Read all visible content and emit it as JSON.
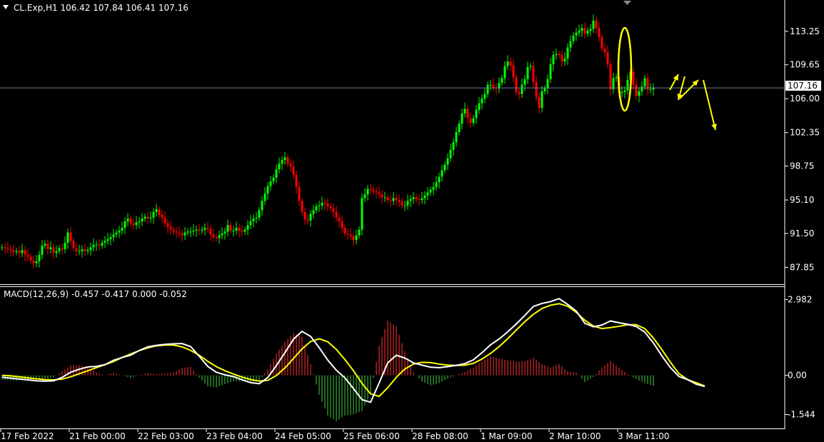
{
  "header": {
    "symbol_text": "CL.Exp,H1  106.42 107.84 106.41 107.16"
  },
  "macd_header": {
    "text": "MACD(12,26,9) -0.457 -0.417 0.000 -0.052"
  },
  "current_price_label": "107.16",
  "colors": {
    "background": "#000000",
    "bull": "#00ff00",
    "bear": "#ff0000",
    "axis": "#ffffff",
    "price_line": "#6f7f9a",
    "macd_line": "#ffffff",
    "signal_line": "#ffff00",
    "hist_pos": "#b22222",
    "hist_neg": "#2e8b2e",
    "annotation": "#ffff00"
  },
  "chart_data": [
    {
      "type": "candlestick",
      "title": "CL.Exp,H1",
      "ohlc_last": {
        "open": 106.42,
        "high": 107.84,
        "low": 106.41,
        "close": 107.16
      },
      "ylim": [
        86.5,
        116.0
      ],
      "y_ticks": [
        "113.25",
        "109.65",
        "106.00",
        "102.35",
        "98.75",
        "95.10",
        "91.50",
        "87.85"
      ],
      "y_tick_values": [
        113.25,
        109.65,
        106.0,
        102.35,
        98.75,
        95.1,
        91.5,
        87.85
      ],
      "x_ticks": [
        "17 Feb 2022",
        "21 Feb 00:00",
        "22 Feb 03:00",
        "23 Feb 04:00",
        "24 Feb 05:00",
        "25 Feb 06:00",
        "28 Feb 08:00",
        "1 Mar 09:00",
        "2 Mar 10:00",
        "3 Mar 11:00"
      ],
      "x_tick_bars": [
        0,
        24,
        48,
        72,
        96,
        120,
        144,
        168,
        192,
        216
      ],
      "closes": [
        90.0,
        89.9,
        89.8,
        89.7,
        89.5,
        89.6,
        89.4,
        89.7,
        89.2,
        89.0,
        88.6,
        88.3,
        88.5,
        89.2,
        90.2,
        90.4,
        89.8,
        90.0,
        89.4,
        89.6,
        89.9,
        89.8,
        90.5,
        91.6,
        90.7,
        89.9,
        89.6,
        89.6,
        89.8,
        89.6,
        89.7,
        90.0,
        90.3,
        90.3,
        90.2,
        90.5,
        90.7,
        90.9,
        91.1,
        91.4,
        91.6,
        91.8,
        92.1,
        92.8,
        93.1,
        92.6,
        92.4,
        92.7,
        92.8,
        93.1,
        93.3,
        93.1,
        93.2,
        93.8,
        94.1,
        93.5,
        93.2,
        92.6,
        92.2,
        91.9,
        91.7,
        91.6,
        91.5,
        91.3,
        91.6,
        91.7,
        91.7,
        91.8,
        91.9,
        91.8,
        91.9,
        92.1,
        92.0,
        91.4,
        91.1,
        91.0,
        91.3,
        91.5,
        91.7,
        92.4,
        91.8,
        91.8,
        92.1,
        91.8,
        91.7,
        91.9,
        92.4,
        92.8,
        93.1,
        93.2,
        94.0,
        95.0,
        95.8,
        96.6,
        97.1,
        97.5,
        98.4,
        99.0,
        99.4,
        99.7,
        99.0,
        98.7,
        97.8,
        96.5,
        95.0,
        93.8,
        93.0,
        92.9,
        93.6,
        94.0,
        94.4,
        94.5,
        94.8,
        94.7,
        94.4,
        94.2,
        93.8,
        93.2,
        92.8,
        92.1,
        91.5,
        91.4,
        91.2,
        90.8,
        91.3,
        91.9,
        95.3,
        95.7,
        96.3,
        96.2,
        96.0,
        95.9,
        95.7,
        95.4,
        95.4,
        95.1,
        95.0,
        95.3,
        95.1,
        94.9,
        94.5,
        94.5,
        95.0,
        95.2,
        95.4,
        95.2,
        95.1,
        95.3,
        95.6,
        95.9,
        96.2,
        96.5,
        97.0,
        97.6,
        98.3,
        98.9,
        99.6,
        100.5,
        101.3,
        102.4,
        103.3,
        104.4,
        104.9,
        103.9,
        103.4,
        103.9,
        104.8,
        105.5,
        106.0,
        106.5,
        107.5,
        107.5,
        107.2,
        107.1,
        107.7,
        108.2,
        109.5,
        110.0,
        109.6,
        108.3,
        106.7,
        106.5,
        107.5,
        108.1,
        109.4,
        109.5,
        107.8,
        106.2,
        105.0,
        106.8,
        107.1,
        108.1,
        109.7,
        110.7,
        110.8,
        110.7,
        110.0,
        110.3,
        111.5,
        112.2,
        112.8,
        113.1,
        113.3,
        113.6,
        113.0,
        113.3,
        113.5,
        114.4,
        113.6,
        112.6,
        111.4,
        111.0,
        109.7,
        107.0,
        108.2,
        108.3,
        106.6,
        106.7,
        106.9,
        108.0,
        108.9,
        107.5,
        106.3,
        106.8,
        107.3,
        108.2,
        107.0,
        107.0,
        107.2
      ],
      "series": [
        {
          "name": "",
          "values": []
        }
      ]
    },
    {
      "type": "line",
      "title": "MACD(12,26,9)",
      "values_header": [
        -0.457,
        -0.417,
        0.0,
        -0.052
      ],
      "ylim": [
        -1.98,
        3.25
      ],
      "y_ticks": [
        "2.982",
        "0.00",
        "-1.544"
      ],
      "y_tick_values": [
        2.982,
        0.0,
        -1.544
      ],
      "zero_line": 0.0,
      "macd": [
        -0.08,
        -0.11,
        -0.15,
        -0.18,
        -0.22,
        -0.23,
        -0.22,
        -0.08,
        0.12,
        0.24,
        0.33,
        0.35,
        0.42,
        0.59,
        0.7,
        0.79,
        0.98,
        1.12,
        1.18,
        1.22,
        1.24,
        1.25,
        1.13,
        0.75,
        0.35,
        0.12,
        0.02,
        -0.05,
        -0.18,
        -0.29,
        -0.33,
        -0.09,
        0.38,
        0.89,
        1.42,
        1.73,
        1.53,
        1.09,
        0.6,
        0.2,
        -0.1,
        -0.52,
        -0.96,
        -1.06,
        -0.3,
        0.49,
        0.79,
        0.68,
        0.49,
        0.4,
        0.32,
        0.3,
        0.34,
        0.39,
        0.46,
        0.61,
        0.89,
        1.2,
        1.43,
        1.71,
        2.02,
        2.36,
        2.71,
        2.83,
        2.9,
        3.02,
        2.79,
        2.53,
        2.05,
        1.91,
        1.98,
        2.14,
        2.07,
        2.01,
        1.92,
        1.7,
        1.28,
        0.76,
        0.3,
        -0.05,
        -0.17,
        -0.35,
        -0.44
      ],
      "signal": [
        0.0,
        -0.02,
        -0.06,
        -0.1,
        -0.14,
        -0.17,
        -0.18,
        -0.15,
        -0.06,
        0.06,
        0.18,
        0.3,
        0.42,
        0.54,
        0.7,
        0.84,
        0.97,
        1.08,
        1.16,
        1.19,
        1.19,
        1.12,
        0.98,
        0.79,
        0.55,
        0.34,
        0.18,
        0.05,
        -0.07,
        -0.17,
        -0.23,
        -0.2,
        -0.01,
        0.29,
        0.66,
        1.04,
        1.33,
        1.44,
        1.32,
        1.02,
        0.62,
        0.18,
        -0.32,
        -0.73,
        -0.83,
        -0.49,
        -0.08,
        0.25,
        0.44,
        0.51,
        0.5,
        0.44,
        0.4,
        0.39,
        0.4,
        0.47,
        0.64,
        0.86,
        1.13,
        1.44,
        1.78,
        2.11,
        2.4,
        2.63,
        2.76,
        2.82,
        2.72,
        2.48,
        2.17,
        1.94,
        1.84,
        1.88,
        1.93,
        1.99,
        1.99,
        1.84,
        1.47,
        1.01,
        0.51,
        0.06,
        -0.17,
        -0.29,
        -0.42
      ],
      "hist_step": 3,
      "histogram_note": "red bars above zero, green bars below zero"
    }
  ],
  "annotations": {
    "ellipse": "yellow ellipse around sharp drop near 3 Mar",
    "arrows": [
      "up",
      "up",
      "down"
    ]
  }
}
